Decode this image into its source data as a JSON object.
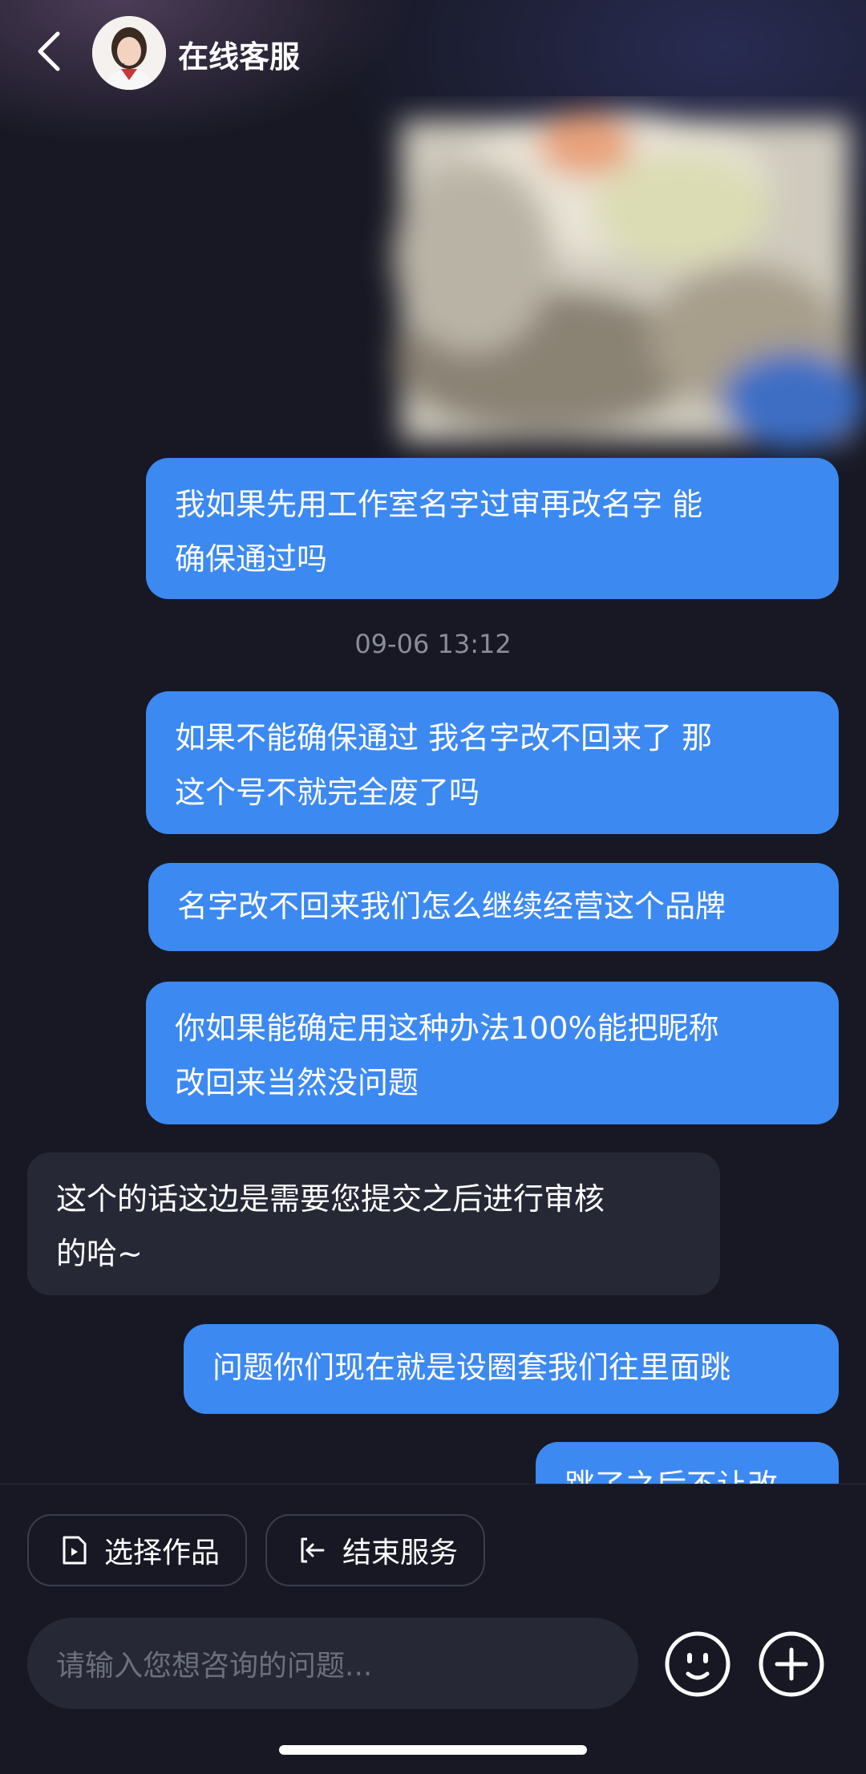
{
  "header": {
    "title": "在线客服",
    "back_icon": "chevron-left-icon",
    "avatar": "customer-service-avatar"
  },
  "messages": [
    {
      "side": "out",
      "text_line1": "我如果先用工作室名字过审再改名字 能",
      "text_line2": "确保通过吗"
    },
    {
      "side": "out",
      "text_line1": "如果不能确保通过 我名字改不回来了 那",
      "text_line2": "这个号不就完全废了吗"
    },
    {
      "side": "out",
      "text_line1": "名字改不回来我们怎么继续经营这个品牌"
    },
    {
      "side": "out",
      "text_line1": "你如果能确定用这种办法100%能把昵称",
      "text_line2": "改回来当然没问题"
    },
    {
      "side": "in",
      "text_line1": "这个的话这边是需要您提交之后进行审核",
      "text_line2": "的哈~"
    },
    {
      "side": "out",
      "text_line1": "问题你们现在就是设圈套我们往里面跳"
    },
    {
      "side": "out",
      "text_line1": "跳了之后不让改"
    }
  ],
  "timestamp": "09-06 13:12",
  "actions": {
    "select_work": "选择作品",
    "end_service": "结束服务"
  },
  "input": {
    "placeholder": "请输入您想咨询的问题..."
  },
  "icons": {
    "emoji": "emoji-icon",
    "plus": "plus-icon"
  },
  "colors": {
    "outgoing_bubble": "#3c89f1",
    "incoming_bubble": "#262835",
    "background": "#171824"
  }
}
